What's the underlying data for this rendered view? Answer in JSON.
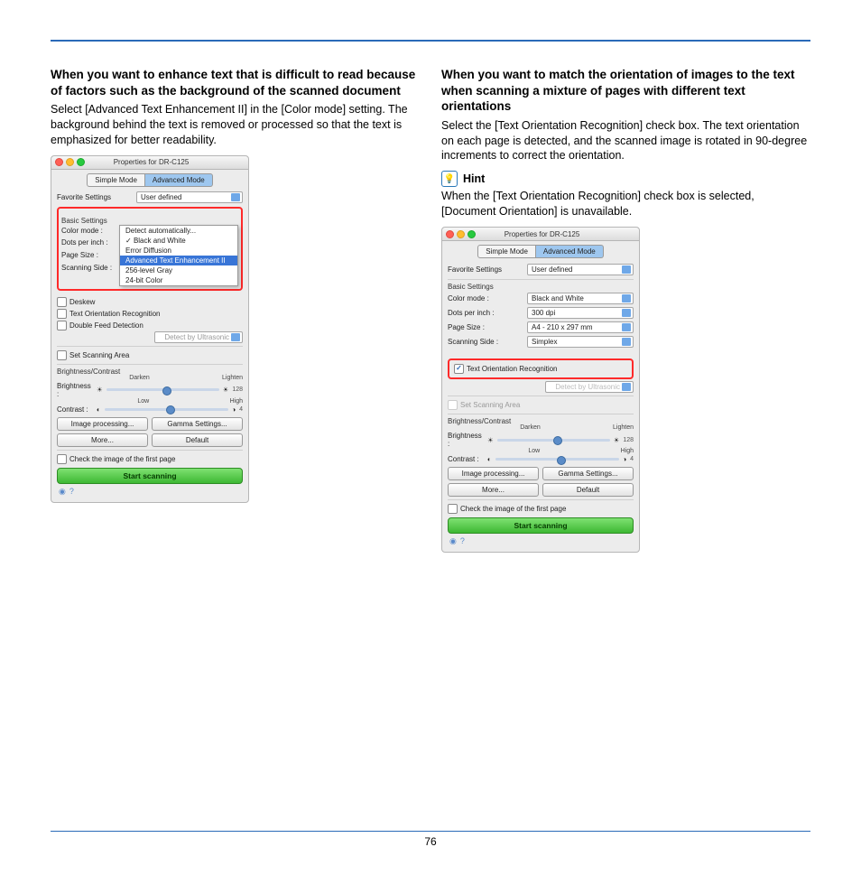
{
  "page_number": "76",
  "left": {
    "heading": "When you want to enhance text that is difficult to read because of factors such as the background of the scanned document",
    "body": "Select [Advanced Text Enhancement II] in the [Color mode] setting. The background behind the text is removed or processed so that the text is emphasized for better readability.",
    "window": {
      "title": "Properties for DR-C125",
      "tab_simple": "Simple Mode",
      "tab_advanced": "Advanced Mode",
      "favorite_label": "Favorite Settings",
      "favorite_value": "User defined",
      "basic_header": "Basic Settings",
      "color_label": "Color mode :",
      "dpi_label": "Dots per inch :",
      "page_label": "Page Size :",
      "side_label": "Scanning Side :",
      "dropdown": {
        "detect": "Detect automatically...",
        "bw": "Black and White",
        "err": "Error Diffusion",
        "ate2": "Advanced Text Enhancement II",
        "gray": "256-level Gray",
        "color": "24-bit Color"
      },
      "deskew": "Deskew",
      "text_orient": "Text Orientation Recognition",
      "dfd": "Double Feed Detection",
      "detect_ultra": "Detect by Ultrasonic",
      "set_scan_area": "Set Scanning Area",
      "bc_header": "Brightness/Contrast",
      "brightness": "Brightness :",
      "contrast": "Contrast :",
      "darken": "Darken",
      "lighten": "Lighten",
      "brightness_val": "128",
      "low": "Low",
      "high": "High",
      "contrast_val": "4",
      "imgproc": "Image processing...",
      "gamma": "Gamma Settings...",
      "more": "More...",
      "default": "Default",
      "check_first": "Check the image of the first page",
      "start": "Start scanning",
      "check_mark": "✓"
    }
  },
  "right": {
    "heading": "When you want to match the orientation of images to the text when scanning a mixture of pages with different text orientations",
    "body": "Select the [Text Orientation Recognition] check box. The text orientation on each page is detected, and the scanned image is rotated in 90-degree increments to correct the orientation.",
    "hint_label": "Hint",
    "hint_body": "When the [Text Orientation Recognition] check box is selected, [Document Orientation] is unavailable.",
    "window": {
      "title": "Properties for DR-C125",
      "tab_simple": "Simple Mode",
      "tab_advanced": "Advanced Mode",
      "favorite_label": "Favorite Settings",
      "favorite_value": "User defined",
      "basic_header": "Basic Settings",
      "color_label": "Color mode :",
      "color_value": "Black and White",
      "dpi_label": "Dots per inch :",
      "dpi_value": "300 dpi",
      "page_label": "Page Size :",
      "page_value": "A4 - 210 x 297 mm",
      "side_label": "Scanning Side :",
      "side_value": "Simplex",
      "text_orient": "Text Orientation Recognition",
      "detect_ultra": "Detect by Ultrasonic",
      "set_scan_area": "Set Scanning Area",
      "bc_header": "Brightness/Contrast",
      "brightness": "Brightness :",
      "contrast": "Contrast :",
      "darken": "Darken",
      "lighten": "Lighten",
      "brightness_val": "128",
      "low": "Low",
      "high": "High",
      "contrast_val": "4",
      "imgproc": "Image processing...",
      "gamma": "Gamma Settings...",
      "more": "More...",
      "default": "Default",
      "check_first": "Check the image of the first page",
      "start": "Start scanning"
    }
  }
}
